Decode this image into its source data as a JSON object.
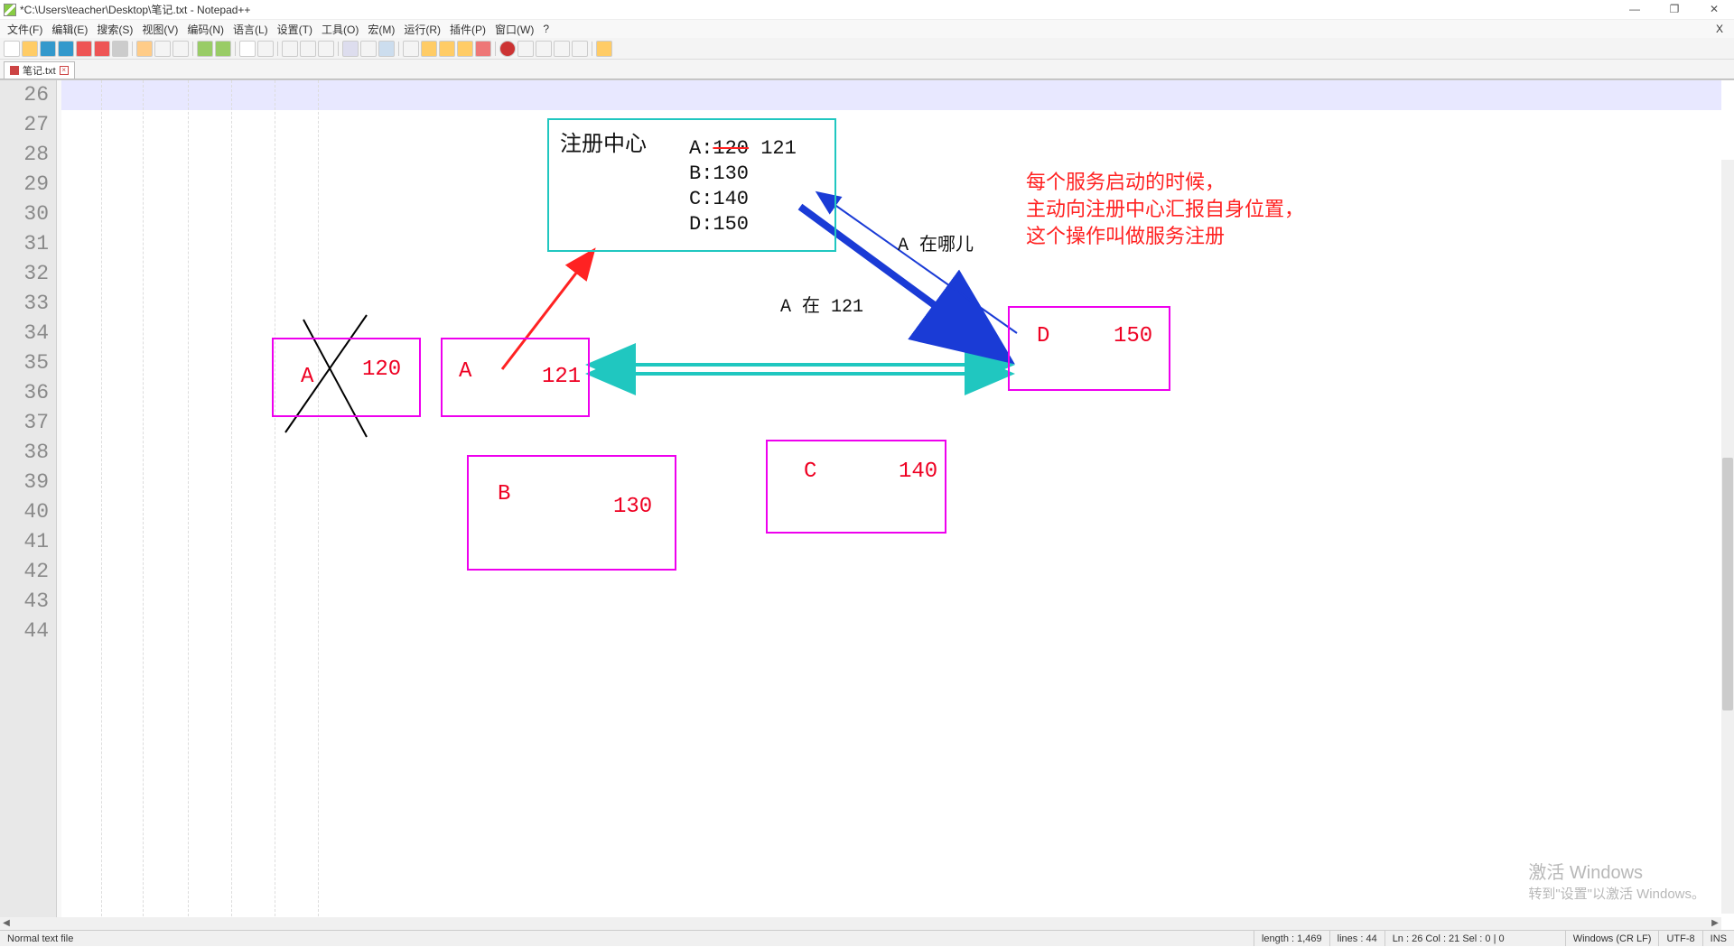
{
  "window": {
    "title": "*C:\\Users\\teacher\\Desktop\\笔记.txt - Notepad++",
    "min": "—",
    "max": "❐",
    "close": "✕",
    "x": "X"
  },
  "menus": [
    "文件(F)",
    "编辑(E)",
    "搜索(S)",
    "视图(V)",
    "编码(N)",
    "语言(L)",
    "设置(T)",
    "工具(O)",
    "宏(M)",
    "运行(R)",
    "插件(P)",
    "窗口(W)",
    "?"
  ],
  "tab": {
    "name": "笔记.txt",
    "close": "×"
  },
  "lines": [
    26,
    27,
    28,
    29,
    30,
    31,
    32,
    33,
    34,
    35,
    36,
    37,
    38,
    39,
    40,
    41,
    42,
    43,
    44
  ],
  "registry": {
    "title": "注册中心",
    "rows": [
      "A:120 121",
      "B:130",
      "C:140",
      "D:150"
    ],
    "strike": "120"
  },
  "boxes": {
    "a1": {
      "label": "A",
      "val": "120"
    },
    "a2": {
      "label": "A",
      "val": "121"
    },
    "b": {
      "label": "B",
      "val": "130"
    },
    "c": {
      "label": "C",
      "val": "140"
    },
    "d": {
      "label": "D",
      "val": "150"
    }
  },
  "labels": {
    "q": "A 在哪儿",
    "ans": "A 在 121"
  },
  "note": {
    "l1": "每个服务启动的时候，",
    "l2": "主动向注册中心汇报自身位置，",
    "l3": "这个操作叫做服务注册"
  },
  "status": {
    "type": "Normal text file",
    "length": "length : 1,469",
    "lines": "lines : 44",
    "pos": "Ln : 26   Col : 21   Sel : 0 | 0",
    "eol": "Windows (CR LF)",
    "enc": "UTF-8",
    "ins": "INS"
  },
  "watermark": {
    "l1": "激活 Windows",
    "l2": "转到\"设置\"以激活 Windows。"
  }
}
